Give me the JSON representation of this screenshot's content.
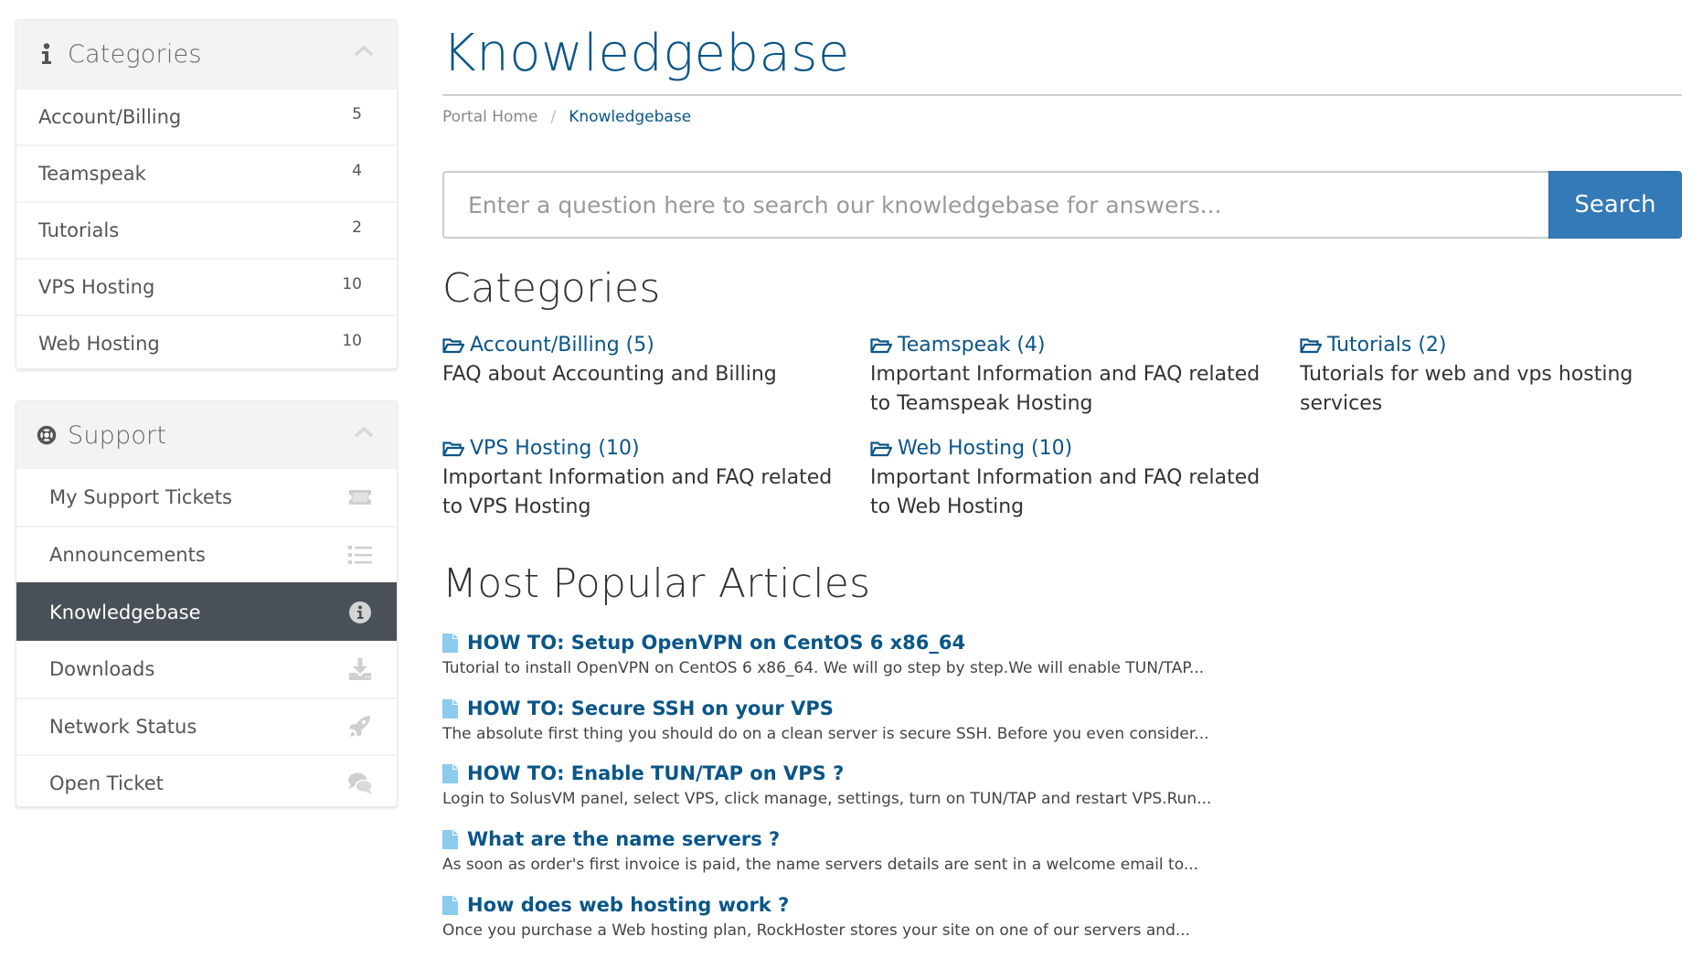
{
  "sidebar": {
    "categories_panel": {
      "title": "Categories",
      "icon": "info-icon",
      "items": [
        {
          "label": "Account/Billing",
          "count": "5"
        },
        {
          "label": "Teamspeak",
          "count": "4"
        },
        {
          "label": "Tutorials",
          "count": "2"
        },
        {
          "label": "VPS Hosting",
          "count": "10"
        },
        {
          "label": "Web Hosting",
          "count": "10"
        }
      ]
    },
    "support_panel": {
      "title": "Support",
      "icon": "life-ring-icon",
      "items": [
        {
          "label": "My Support Tickets",
          "icon": "ticket-icon",
          "active": false
        },
        {
          "label": "Announcements",
          "icon": "list-icon",
          "active": false
        },
        {
          "label": "Knowledgebase",
          "icon": "info-circle-icon",
          "active": true
        },
        {
          "label": "Downloads",
          "icon": "download-icon",
          "active": false
        },
        {
          "label": "Network Status",
          "icon": "rocket-icon",
          "active": false
        },
        {
          "label": "Open Ticket",
          "icon": "comments-icon",
          "active": false
        }
      ]
    }
  },
  "header": {
    "title": "Knowledgebase",
    "breadcrumb": [
      {
        "label": "Portal Home"
      },
      {
        "label": "Knowledgebase"
      }
    ],
    "breadcrumb_separator": "/"
  },
  "search": {
    "placeholder": "Enter a question here to search our knowledgebase for answers...",
    "value": "",
    "button_label": "Search"
  },
  "categories": {
    "heading": "Categories",
    "items": [
      {
        "label": "Account/Billing (5)",
        "description": [
          "FAQ about Accounting and Billing"
        ]
      },
      {
        "label": "Teamspeak (4)",
        "description": [
          "Important Information and FAQ related",
          "to Teamspeak Hosting"
        ]
      },
      {
        "label": "Tutorials (2)",
        "description": [
          "Tutorials for web and vps hosting",
          "services"
        ]
      },
      {
        "label": "VPS Hosting (10)",
        "description": [
          "Important Information and FAQ related",
          "to VPS Hosting"
        ]
      },
      {
        "label": "Web Hosting (10)",
        "description": [
          "Important Information and FAQ related",
          "to Web Hosting"
        ]
      }
    ]
  },
  "popular": {
    "heading": "Most Popular Articles",
    "articles": [
      {
        "title": "HOW TO: Setup OpenVPN on CentOS 6 x86_64",
        "excerpt": "Tutorial to install OpenVPN on CentOS 6 x86_64. We will go step by step.We will enable TUN/TAP..."
      },
      {
        "title": "HOW TO: Secure SSH on your VPS",
        "excerpt": "The absolute first thing you should do on a clean server is secure SSH. Before you even consider..."
      },
      {
        "title": "HOW TO: Enable TUN/TAP on VPS ?",
        "excerpt": "Login to SolusVM panel, select VPS, click manage,  settings, turn on TUN/TAP and restart VPS.Run..."
      },
      {
        "title": "What are the name servers ?",
        "excerpt": "As soon as order's first invoice is paid, the name servers details are sent in a welcome email to..."
      },
      {
        "title": "How does web hosting work ?",
        "excerpt": "Once you purchase a Web hosting plan, RockHoster stores your site on one of our servers and..."
      }
    ]
  },
  "colors": {
    "link": "#0a5688",
    "search_button": "#337ab7",
    "active_item_bg": "#495057",
    "file_icon": "#8ccbed"
  }
}
